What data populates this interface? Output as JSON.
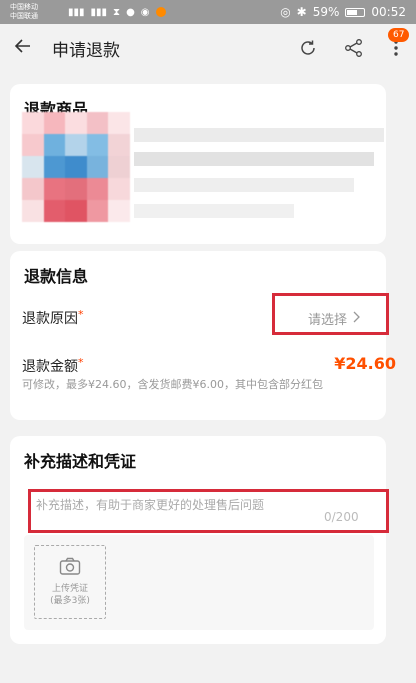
{
  "status_bar": {
    "carrier1": "中国移动",
    "carrier2": "中国联通",
    "battery_text": "59%",
    "battery_level": 0.59,
    "time": "00:52"
  },
  "header": {
    "title": "申请退款",
    "badge": "67",
    "icons": [
      "back-arrow-icon",
      "refresh-icon",
      "share-icon",
      "more-icon"
    ]
  },
  "product": {
    "section_title": "退款商品"
  },
  "refund_info": {
    "section_title": "退款信息",
    "reason_label": "退款原因",
    "reason_placeholder": "请选择",
    "amount_label": "退款金额",
    "amount_value": "¥24.60",
    "note": "可修改，最多¥24.60，含发货邮费¥6.00，其中包含部分红包",
    "required_mark": "*"
  },
  "evidence": {
    "section_title": "补充描述和凭证",
    "description_placeholder": "补充描述，有助于商家更好的处理售后问题",
    "counter": "0/200",
    "upload_label_line1": "上传凭证",
    "upload_label_line2": "(最多3张)"
  },
  "colors": {
    "accent": "#ff5000",
    "annotation": "#d62b3a",
    "badge": "#ff5a00"
  }
}
